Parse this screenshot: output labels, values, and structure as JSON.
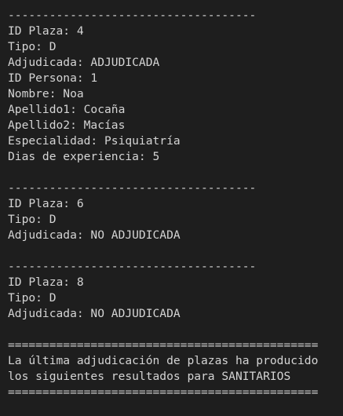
{
  "terminal": {
    "lines": [
      "------------------------------------",
      "ID Plaza: 4",
      "Tipo: D",
      "Adjudicada: ADJUDICADA",
      "ID Persona: 1",
      "Nombre: Noa",
      "Apellido1: Cocaña",
      "Apellido2: Macías",
      "Especialidad: Psiquiatría",
      "Dias de experiencia: 5",
      "",
      "------------------------------------",
      "ID Plaza: 6",
      "Tipo: D",
      "Adjudicada: NO ADJUDICADA",
      "",
      "------------------------------------",
      "ID Plaza: 8",
      "Tipo: D",
      "Adjudicada: NO ADJUDICADA",
      "",
      "=============================================",
      "La última adjudicación de plazas ha producido",
      "los siguientes resultados para SANITARIOS",
      "============================================="
    ]
  },
  "colors": {
    "background": "#1e1e1e",
    "text": "#d4d4d4"
  }
}
